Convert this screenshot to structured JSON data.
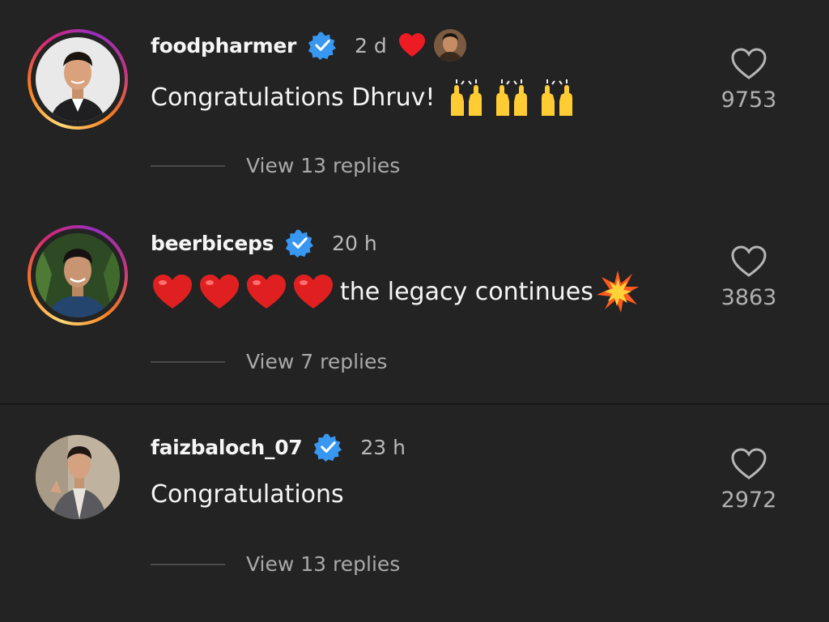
{
  "comments": [
    {
      "username": "foodpharmer",
      "verified": true,
      "time": "2 d",
      "liked_by_creator": true,
      "text": "Congratulations Dhruv!",
      "emoji": [
        "raising-hands",
        "raising-hands",
        "raising-hands"
      ],
      "replies": "View 13 replies",
      "likes": "9753",
      "has_story_ring": true
    },
    {
      "username": "beerbiceps",
      "verified": true,
      "time": "20 h",
      "text": "the legacy continues",
      "emoji_prefix": [
        "red-heart",
        "red-heart",
        "red-heart",
        "red-heart"
      ],
      "emoji_suffix": "collision",
      "replies": "View 7 replies",
      "likes": "3863",
      "has_story_ring": true
    },
    {
      "username": "faizbaloch_07",
      "verified": true,
      "time": "23 h",
      "text": "Congratulations",
      "replies": "View 13 replies",
      "likes": "2972",
      "has_story_ring": false
    }
  ],
  "colors": {
    "background": "#232323",
    "verified_blue": "#3897f0",
    "heart_red": "#ed1c24",
    "muted_text": "#a9a9a9"
  }
}
